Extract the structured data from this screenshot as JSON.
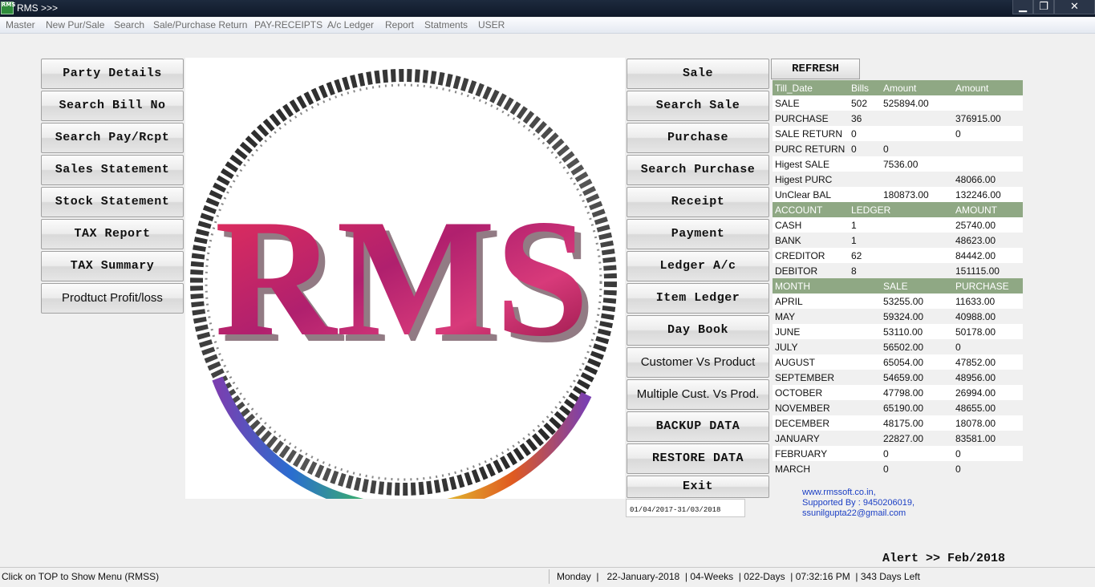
{
  "window": {
    "app_icon_text": "RMS",
    "title": "RMS >>>",
    "minimize_glyph": "▁",
    "maximize_glyph": "❐",
    "close_glyph": "✕"
  },
  "menu": [
    "Master",
    "New Pur/Sale",
    "Search",
    "Sale/Purchase Return",
    "PAY-RECEIPTS",
    "A/c Ledger",
    "Report",
    "Statments",
    "USER"
  ],
  "left_buttons": [
    "Party Details",
    "Search Bill No",
    "Search Pay/Rcpt",
    "Sales Statement",
    "Stock Statement",
    "TAX Report",
    "TAX Summary",
    "Prodtuct Profit/loss"
  ],
  "right_buttons": [
    "Sale",
    "Search Sale",
    "Purchase",
    "Search Purchase",
    "Receipt",
    "Payment",
    "Ledger A/c",
    "Item Ledger",
    "Day Book",
    "Customer Vs Product",
    "Multiple Cust. Vs Prod.",
    "BACKUP DATA",
    "RESTORE DATA",
    "Exit"
  ],
  "logo": {
    "text": "RMS"
  },
  "refresh_label": "REFRESH",
  "summary": {
    "headers": [
      "Till_Date",
      "Bills",
      "Amount",
      "Amount"
    ],
    "rows": [
      [
        "SALE",
        "502",
        "525894.00",
        ""
      ],
      [
        "PURCHASE",
        "36",
        "",
        "376915.00"
      ],
      [
        "SALE RETURN",
        "0",
        "",
        "0"
      ],
      [
        "PURC RETURN",
        "0",
        "0",
        ""
      ],
      [
        "Higest SALE",
        "",
        "7536.00",
        ""
      ],
      [
        "Higest PURC",
        "",
        "",
        "48066.00"
      ],
      [
        "UnClear BAL",
        "",
        "180873.00",
        "132246.00"
      ]
    ]
  },
  "accounts": {
    "headers": [
      "ACCOUNT",
      "LEDGER",
      "AMOUNT"
    ],
    "rows": [
      [
        "CASH",
        "1",
        "25740.00"
      ],
      [
        "BANK",
        "1",
        "48623.00"
      ],
      [
        "CREDITOR",
        "62",
        "84442.00"
      ],
      [
        "DEBITOR",
        "8",
        "151115.00"
      ]
    ]
  },
  "monthly": {
    "headers": [
      "MONTH",
      "SALE",
      "PURCHASE"
    ],
    "rows": [
      [
        "APRIL",
        "53255.00",
        "11633.00"
      ],
      [
        "MAY",
        "59324.00",
        "40988.00"
      ],
      [
        "JUNE",
        "53110.00",
        "50178.00"
      ],
      [
        "JULY",
        "56502.00",
        "0"
      ],
      [
        "AUGUST",
        "65054.00",
        "47852.00"
      ],
      [
        "SEPTEMBER",
        "54659.00",
        "48956.00"
      ],
      [
        "OCTOBER",
        "47798.00",
        "26994.00"
      ],
      [
        "NOVEMBER",
        "65190.00",
        "48655.00"
      ],
      [
        "DECEMBER",
        "48175.00",
        "18078.00"
      ],
      [
        "JANUARY",
        "22827.00",
        "83581.00"
      ],
      [
        "FEBRUARY",
        "0",
        "0"
      ],
      [
        "MARCH",
        "0",
        "0"
      ]
    ]
  },
  "support": {
    "website": "www.rmssoft.co.in,",
    "supported_by": "Supported By : 9450206019,",
    "email": "ssunilgupta22@gmail.com"
  },
  "financial_year": "01/04/2017-31/03/2018",
  "alert": "Alert >> Feb/2018",
  "status": {
    "left": "Click on TOP to Show Menu (RMSS)",
    "right": "Monday  |   22-January-2018  | 04-Weeks  | 022-Days  | 07:32:16 PM  | 343 Days Left"
  },
  "colors": {
    "grid_header": "#8fa884",
    "link": "#1a3ec4",
    "logo_red": "#c01840",
    "logo_magenta": "#b0206e"
  }
}
